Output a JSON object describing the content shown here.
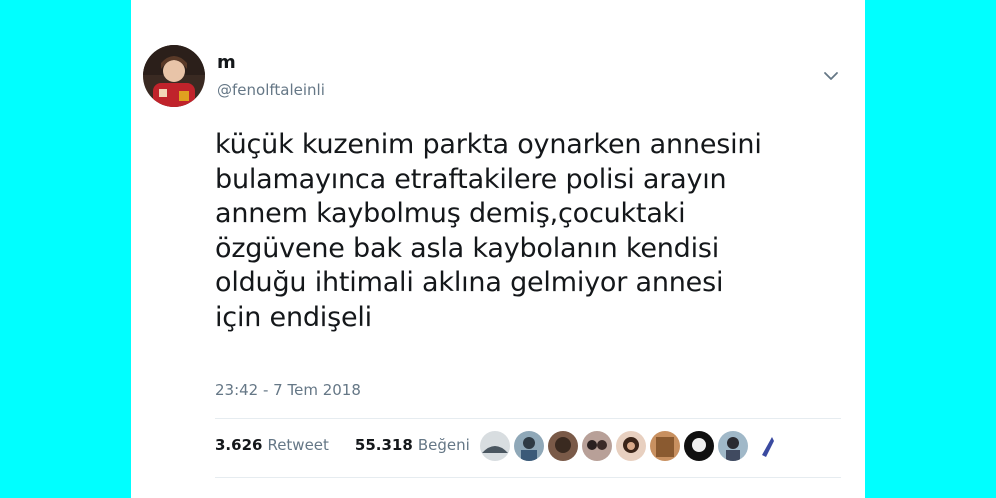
{
  "tweet": {
    "display_name": "m",
    "handle": "@fenolftaleinli",
    "text": "küçük kuzenim parkta oynarken annesini\nbulamayınca etraftakilere polisi arayın\nannem kaybolmuş demiş,çocuktaki\nözgüvene bak asla kaybolanın kendisi\nolduğu ihtimali aklına gelmiyor annesi\niçin endişeli",
    "timestamp": "23:42 - 7 Tem 2018"
  },
  "stats": {
    "retweet_count": "3.626",
    "retweet_label": "Retweet",
    "like_count": "55.318",
    "like_label": "Beğeni"
  },
  "icons": {
    "menu": "chevron-down-icon"
  },
  "colors": {
    "background": "#00ffff",
    "text": "#14171a",
    "secondary": "#657786"
  }
}
